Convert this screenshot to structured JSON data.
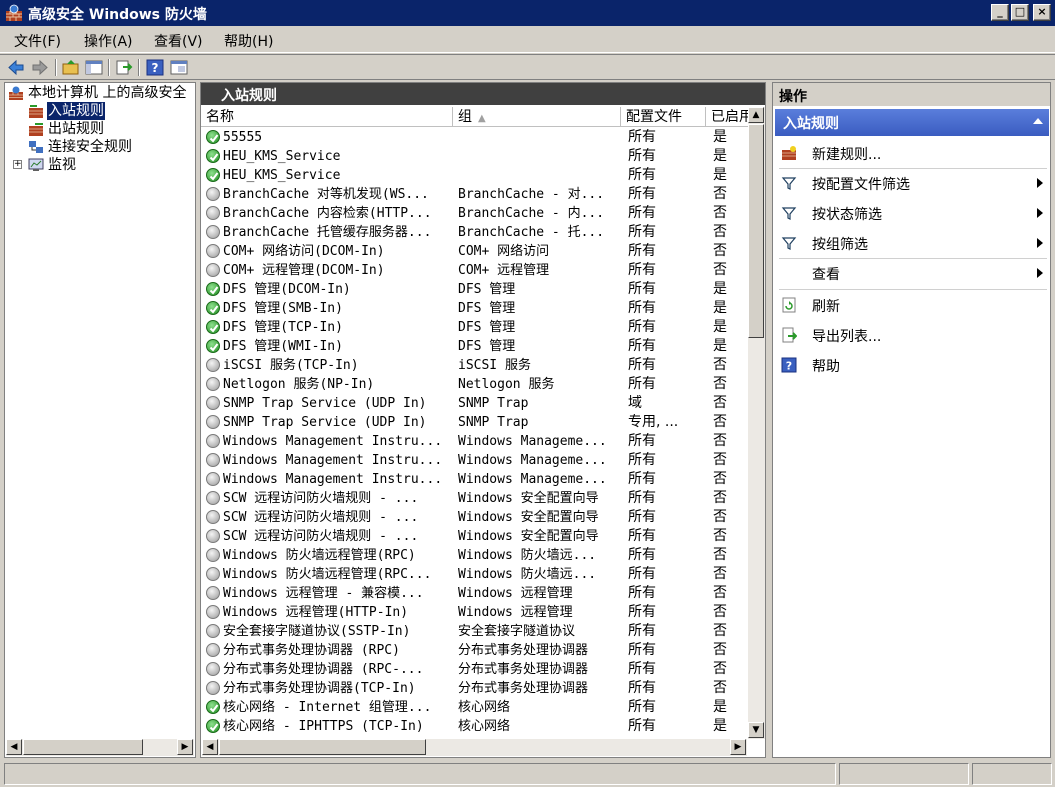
{
  "window": {
    "title": "高级安全 Windows 防火墙"
  },
  "menu": [
    "文件(F)",
    "操作(A)",
    "查看(V)",
    "帮助(H)"
  ],
  "toolbar": [
    "back-icon",
    "forward-icon",
    "up-folder-icon",
    "show-hide-tree-icon",
    "export-icon",
    "help-icon",
    "properties-icon"
  ],
  "tree": {
    "root": "本地计算机 上的高级安全",
    "items": [
      "入站规则",
      "出站规则",
      "连接安全规则",
      "监视"
    ],
    "selected": "入站规则"
  },
  "center": {
    "header": "入站规则",
    "columns": [
      "名称",
      "组",
      "配置文件",
      "已启用"
    ],
    "rows": [
      {
        "name": "55555",
        "group": "",
        "profile": "所有",
        "enabled": "是",
        "on": true
      },
      {
        "name": "HEU_KMS_Service",
        "group": "",
        "profile": "所有",
        "enabled": "是",
        "on": true
      },
      {
        "name": "HEU_KMS_Service",
        "group": "",
        "profile": "所有",
        "enabled": "是",
        "on": true
      },
      {
        "name": "BranchCache 对等机发现(WS...",
        "group": "BranchCache - 对...",
        "profile": "所有",
        "enabled": "否",
        "on": false
      },
      {
        "name": "BranchCache 内容检索(HTTP...",
        "group": "BranchCache - 内...",
        "profile": "所有",
        "enabled": "否",
        "on": false
      },
      {
        "name": "BranchCache 托管缓存服务器...",
        "group": "BranchCache - 托...",
        "profile": "所有",
        "enabled": "否",
        "on": false
      },
      {
        "name": "COM+ 网络访问(DCOM-In)",
        "group": "COM+ 网络访问",
        "profile": "所有",
        "enabled": "否",
        "on": false
      },
      {
        "name": "COM+ 远程管理(DCOM-In)",
        "group": "COM+ 远程管理",
        "profile": "所有",
        "enabled": "否",
        "on": false
      },
      {
        "name": "DFS 管理(DCOM-In)",
        "group": "DFS 管理",
        "profile": "所有",
        "enabled": "是",
        "on": true
      },
      {
        "name": "DFS 管理(SMB-In)",
        "group": "DFS 管理",
        "profile": "所有",
        "enabled": "是",
        "on": true
      },
      {
        "name": "DFS 管理(TCP-In)",
        "group": "DFS 管理",
        "profile": "所有",
        "enabled": "是",
        "on": true
      },
      {
        "name": "DFS 管理(WMI-In)",
        "group": "DFS 管理",
        "profile": "所有",
        "enabled": "是",
        "on": true
      },
      {
        "name": "iSCSI 服务(TCP-In)",
        "group": "iSCSI 服务",
        "profile": "所有",
        "enabled": "否",
        "on": false
      },
      {
        "name": "Netlogon 服务(NP-In)",
        "group": "Netlogon 服务",
        "profile": "所有",
        "enabled": "否",
        "on": false
      },
      {
        "name": "SNMP Trap Service (UDP In)",
        "group": "SNMP Trap",
        "profile": "域",
        "enabled": "否",
        "on": false
      },
      {
        "name": "SNMP Trap Service (UDP In)",
        "group": "SNMP Trap",
        "profile": "专用, ...",
        "enabled": "否",
        "on": false
      },
      {
        "name": "Windows Management Instru...",
        "group": "Windows Manageme...",
        "profile": "所有",
        "enabled": "否",
        "on": false
      },
      {
        "name": "Windows Management Instru...",
        "group": "Windows Manageme...",
        "profile": "所有",
        "enabled": "否",
        "on": false
      },
      {
        "name": "Windows Management Instru...",
        "group": "Windows Manageme...",
        "profile": "所有",
        "enabled": "否",
        "on": false
      },
      {
        "name": "SCW 远程访问防火墙规则 - ...",
        "group": "Windows 安全配置向导",
        "profile": "所有",
        "enabled": "否",
        "on": false
      },
      {
        "name": "SCW 远程访问防火墙规则 - ...",
        "group": "Windows 安全配置向导",
        "profile": "所有",
        "enabled": "否",
        "on": false
      },
      {
        "name": "SCW 远程访问防火墙规则 - ...",
        "group": "Windows 安全配置向导",
        "profile": "所有",
        "enabled": "否",
        "on": false
      },
      {
        "name": "Windows 防火墙远程管理(RPC)",
        "group": "Windows 防火墙远...",
        "profile": "所有",
        "enabled": "否",
        "on": false
      },
      {
        "name": "Windows 防火墙远程管理(RPC...",
        "group": "Windows 防火墙远...",
        "profile": "所有",
        "enabled": "否",
        "on": false
      },
      {
        "name": "Windows 远程管理 - 兼容模...",
        "group": "Windows 远程管理",
        "profile": "所有",
        "enabled": "否",
        "on": false
      },
      {
        "name": "Windows 远程管理(HTTP-In)",
        "group": "Windows 远程管理",
        "profile": "所有",
        "enabled": "否",
        "on": false
      },
      {
        "name": "安全套接字隧道协议(SSTP-In)",
        "group": "安全套接字隧道协议",
        "profile": "所有",
        "enabled": "否",
        "on": false
      },
      {
        "name": "分布式事务处理协调器 (RPC)",
        "group": "分布式事务处理协调器",
        "profile": "所有",
        "enabled": "否",
        "on": false
      },
      {
        "name": "分布式事务处理协调器 (RPC-...",
        "group": "分布式事务处理协调器",
        "profile": "所有",
        "enabled": "否",
        "on": false
      },
      {
        "name": "分布式事务处理协调器(TCP-In)",
        "group": "分布式事务处理协调器",
        "profile": "所有",
        "enabled": "否",
        "on": false
      },
      {
        "name": "核心网络 - Internet 组管理...",
        "group": "核心网络",
        "profile": "所有",
        "enabled": "是",
        "on": true
      },
      {
        "name": "核心网络 - IPHTTPS (TCP-In)",
        "group": "核心网络",
        "profile": "所有",
        "enabled": "是",
        "on": true
      }
    ]
  },
  "actions": {
    "title": "操作",
    "section": "入站规则",
    "items": [
      {
        "label": "新建规则...",
        "icon": "new-rule-icon",
        "submenu": false
      },
      {
        "label": "按配置文件筛选",
        "icon": "filter-icon",
        "submenu": true
      },
      {
        "label": "按状态筛选",
        "icon": "filter-icon",
        "submenu": true
      },
      {
        "label": "按组筛选",
        "icon": "filter-icon",
        "submenu": true
      },
      {
        "label": "查看",
        "icon": "",
        "submenu": true
      },
      {
        "label": "刷新",
        "icon": "refresh-icon",
        "submenu": false
      },
      {
        "label": "导出列表...",
        "icon": "export-list-icon",
        "submenu": false
      },
      {
        "label": "帮助",
        "icon": "help-icon",
        "submenu": false
      }
    ]
  },
  "colors": {
    "titlebar": "#0a246a",
    "selection": "#0a246a",
    "actions_section": "#3a5cc0",
    "enabled_icon": "#1e8c1e",
    "disabled_icon": "#9a9a9a"
  }
}
